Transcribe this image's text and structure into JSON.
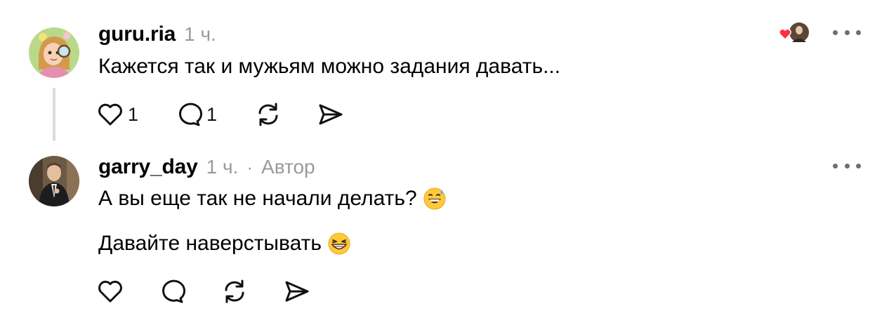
{
  "comments": [
    {
      "username": "guru.ria",
      "time": "1 ч.",
      "text": "Кажется так и мужьям можно задания давать...",
      "likes": "1",
      "replies": "1",
      "avatar": "avatar-cartoon-girl-magnifier",
      "liked_by_indicator": "heart-with-user-avatar"
    },
    {
      "username": "garry_day",
      "time": "1 ч.",
      "separator": "·",
      "badge": "Автор",
      "lines": [
        "А вы еще так не начали делать?",
        "Давайте наверстывать"
      ],
      "avatar": "avatar-man-in-suit",
      "emojis": [
        "grinning-sweat-emoji",
        "beaming-face-emoji"
      ]
    }
  ],
  "icons": {
    "like": "heart-icon",
    "reply": "comment-bubble-icon",
    "repost": "repost-icon",
    "share": "send-icon",
    "more": "more-dots-icon"
  },
  "colors": {
    "text": "#000000",
    "muted": "#9a9a9a",
    "thread_line": "#dcdcdc",
    "heart_red": "#ff3040"
  }
}
